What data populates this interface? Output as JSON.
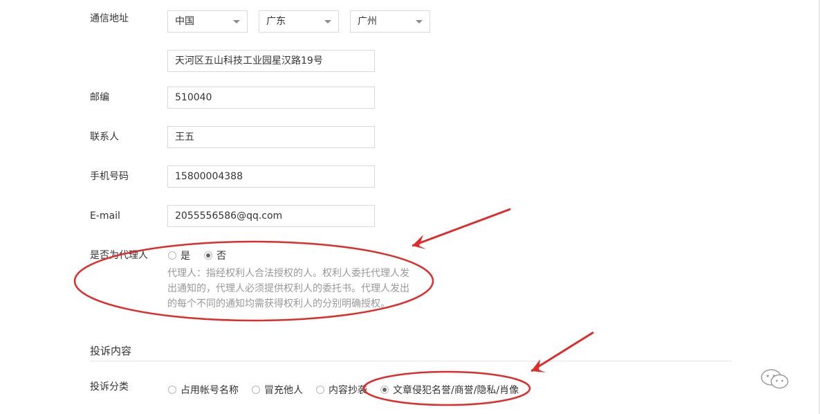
{
  "form": {
    "address": {
      "label": "通信地址",
      "country": "中国",
      "province": "广东",
      "city": "广州",
      "street": "天河区五山科技工业园星汉路19号"
    },
    "postcode": {
      "label": "邮编",
      "value": "510040"
    },
    "contact": {
      "label": "联系人",
      "value": "王五"
    },
    "phone": {
      "label": "手机号码",
      "value": "15800004388"
    },
    "email": {
      "label": "E-mail",
      "value": "2055556586@qq.com"
    },
    "agent": {
      "label": "是否为代理人",
      "options": [
        "是",
        "否"
      ],
      "selected": "否",
      "note": "代理人：指经权利人合法授权的人。权利人委托代理人发出通知的，代理人必须提供权利人的委托书。代理人发出的每个不同的通知均需获得权利人的分别明确授权。"
    }
  },
  "complaint": {
    "section_title": "投诉内容",
    "category_label": "投诉分类",
    "options": [
      "占用帐号名称",
      "冒充他人",
      "内容抄袭",
      "文章侵犯名誉/商誉/隐私/肖像"
    ],
    "selected": "文章侵犯名誉/商誉/隐私/肖像"
  },
  "annotation_color": "#e02b2b",
  "icons": {
    "watermark": "wechat-logo-icon",
    "dropdown": "chevron-down-icon"
  }
}
